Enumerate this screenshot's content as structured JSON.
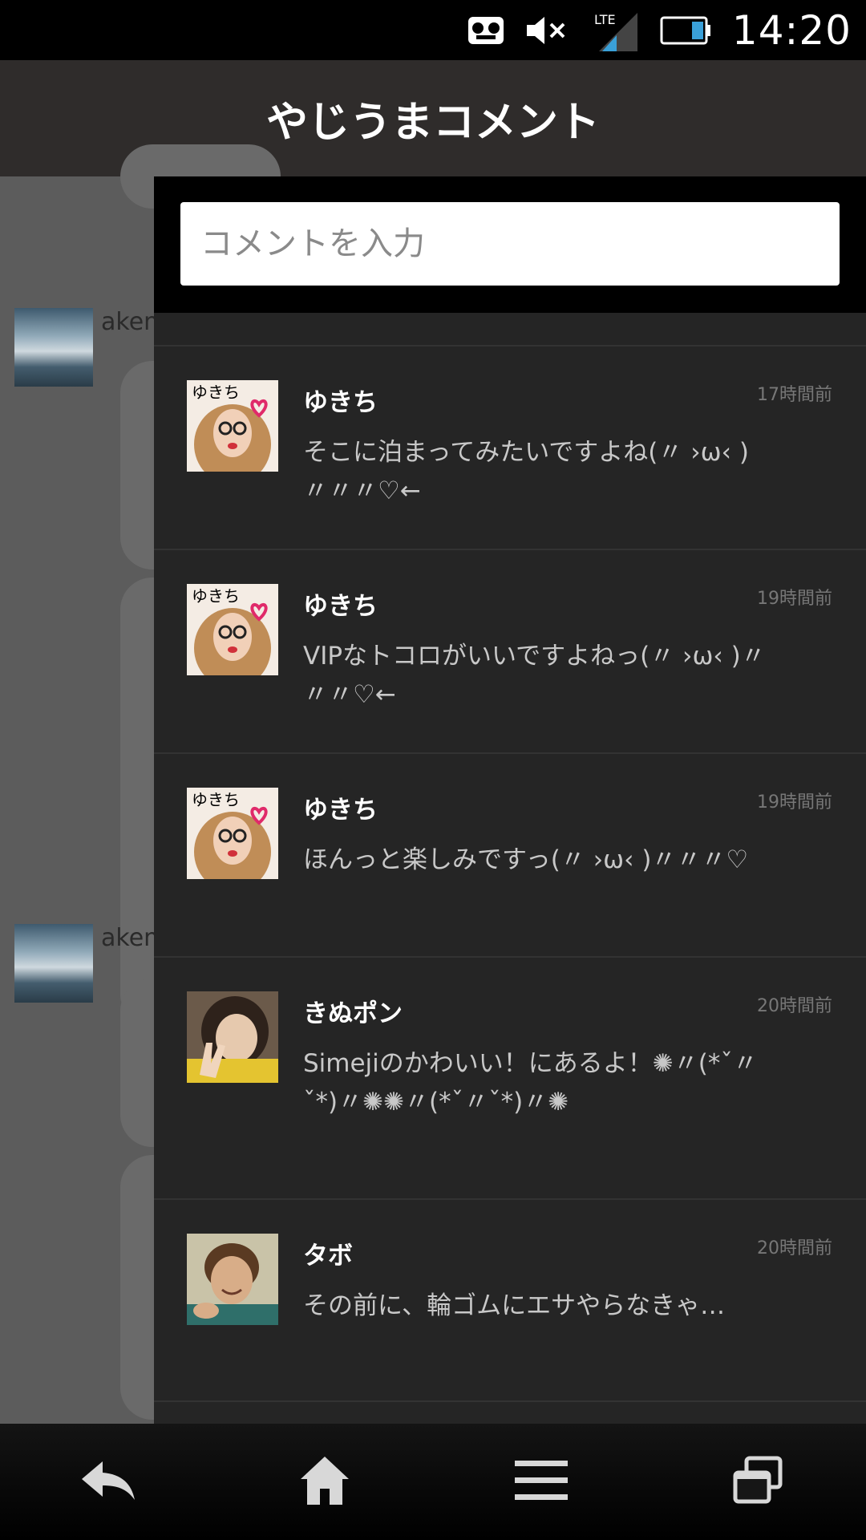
{
  "status_bar": {
    "time": "14:20",
    "network": "LTE",
    "icons": [
      "voicemail-icon",
      "mute-icon",
      "lte-signal-icon",
      "battery-icon"
    ]
  },
  "header": {
    "title": "やじうまコメント"
  },
  "background_feed": {
    "users": [
      {
        "name": "akem"
      },
      {
        "name": "akem"
      }
    ]
  },
  "input": {
    "placeholder": "コメントを入力",
    "value": ""
  },
  "comments": [
    {
      "user": "ゆきち",
      "time": "17時間前",
      "text": "そこに泊まってみたいですよね(〃 ›ω‹ )〃〃〃♡←",
      "avatar": "yukichi"
    },
    {
      "user": "ゆきち",
      "time": "19時間前",
      "text": "VIPなトコロがいいですよねっ(〃 ›ω‹ )〃〃〃♡←",
      "avatar": "yukichi"
    },
    {
      "user": "ゆきち",
      "time": "19時間前",
      "text": "ほんっと楽しみですっ(〃 ›ω‹ )〃〃〃♡",
      "avatar": "yukichi"
    },
    {
      "user": "きぬポン",
      "time": "20時間前",
      "text": "Simejiのかわいい！にあるよ！✺〃(*ˇ〃ˇ*)〃✺✺〃(*ˇ〃ˇ*)〃✺",
      "avatar": "kinupon"
    },
    {
      "user": "タボ",
      "time": "20時間前",
      "text": "その前に、輪ゴムにエサやらなきゃ…",
      "avatar": "tabo"
    }
  ],
  "nav_bar": {
    "buttons": [
      "back-icon",
      "home-icon",
      "menu-icon",
      "recent-apps-icon"
    ]
  }
}
